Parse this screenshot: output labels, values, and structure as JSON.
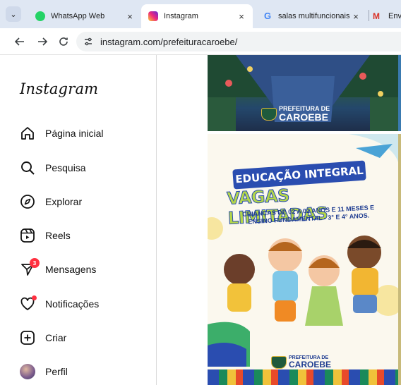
{
  "browser": {
    "tabs": [
      {
        "title": "WhatsApp Web",
        "close": "×"
      },
      {
        "title": "Instagram",
        "close": "×"
      },
      {
        "title": "salas multifuncionais",
        "close": "×"
      },
      {
        "title": "Envi",
        "close": ""
      }
    ],
    "url": "instagram.com/prefeituracaroebe/"
  },
  "sidebar": {
    "logo": "Instagram",
    "items": [
      {
        "label": "Página inicial",
        "icon": "home-icon"
      },
      {
        "label": "Pesquisa",
        "icon": "search-icon"
      },
      {
        "label": "Explorar",
        "icon": "compass-icon"
      },
      {
        "label": "Reels",
        "icon": "reels-icon"
      },
      {
        "label": "Mensagens",
        "icon": "messenger-icon",
        "badge": "3"
      },
      {
        "label": "Notificações",
        "icon": "heart-icon"
      },
      {
        "label": "Criar",
        "icon": "plus-square-icon"
      },
      {
        "label": "Perfil",
        "icon": "avatar"
      }
    ]
  },
  "feed": {
    "post1": {
      "brand_top": "PREFEITURA DE",
      "brand_bottom": "CAROEBE"
    },
    "post2": {
      "ribbon": "EDUCAÇÃO INTEGRAL",
      "headline": "VAGAS LIMITADAS",
      "subline": "CRIANÇAS DE 02 A 02 ANOS E 11 MESES E ENSINO FUNDAMENTAL - 3° E 4° ANOS.",
      "brand_top": "PREFEITURA DE",
      "brand_bottom": "CAROEBE"
    }
  },
  "colors": {
    "accent_badge": "#ff3040",
    "tabbar": "#dfe7f3",
    "brand_blue": "#2a4db0",
    "brand_green": "#b4d64a"
  }
}
